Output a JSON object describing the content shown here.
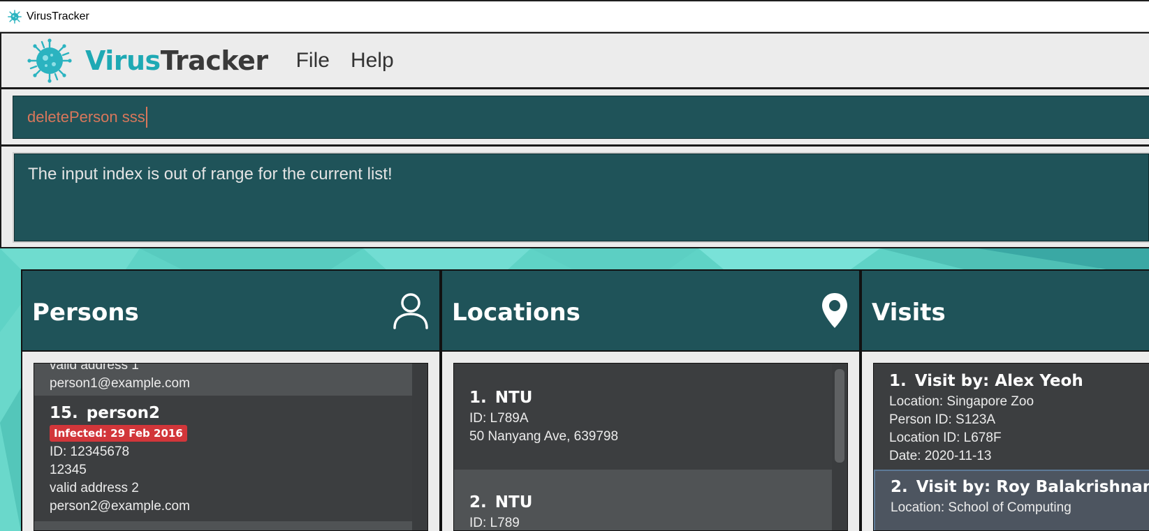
{
  "window": {
    "title": "VirusTracker"
  },
  "brand": {
    "part1": "Virus",
    "part2": "Tracker"
  },
  "menu": {
    "file": "File",
    "help": "Help"
  },
  "command": {
    "value": "deletePerson sss"
  },
  "result": {
    "message": "The input index is out of range for the current list!"
  },
  "panels": {
    "persons": {
      "title": "Persons",
      "partial_top": {
        "line1": "valid address 1",
        "line2": "person1@example.com"
      },
      "card": {
        "index": "15.",
        "name": "person2",
        "badge": "Infected: 29 Feb 2016",
        "id": "ID: 12345678",
        "phone": "12345",
        "address": "valid address 2",
        "email": "person2@example.com"
      }
    },
    "locations": {
      "title": "Locations",
      "cards": [
        {
          "index": "1.",
          "name": "NTU",
          "id": "ID: L789A",
          "address": "50 Nanyang Ave, 639798"
        },
        {
          "index": "2.",
          "name": "NTU",
          "id": "ID: L789"
        }
      ]
    },
    "visits": {
      "title": "Visits",
      "cards": [
        {
          "index": "1.",
          "title": "Visit by: Alex Yeoh",
          "location": "Location: Singapore Zoo",
          "person_id": "Person ID: S123A",
          "location_id": "Location ID: L678F",
          "date": "Date: 2020-11-13"
        },
        {
          "index": "2.",
          "title": "Visit by: Roy Balakrishnan",
          "location": "Location: School of Computing"
        }
      ]
    }
  },
  "colors": {
    "panel": "#1f5359",
    "accent": "#1fa9b4",
    "badge": "#d2363a",
    "command_text": "#d9775b",
    "background": "#5fd3c6"
  },
  "icons": {
    "app": "virus-icon",
    "persons": "person-icon",
    "locations": "location-pin-icon"
  }
}
